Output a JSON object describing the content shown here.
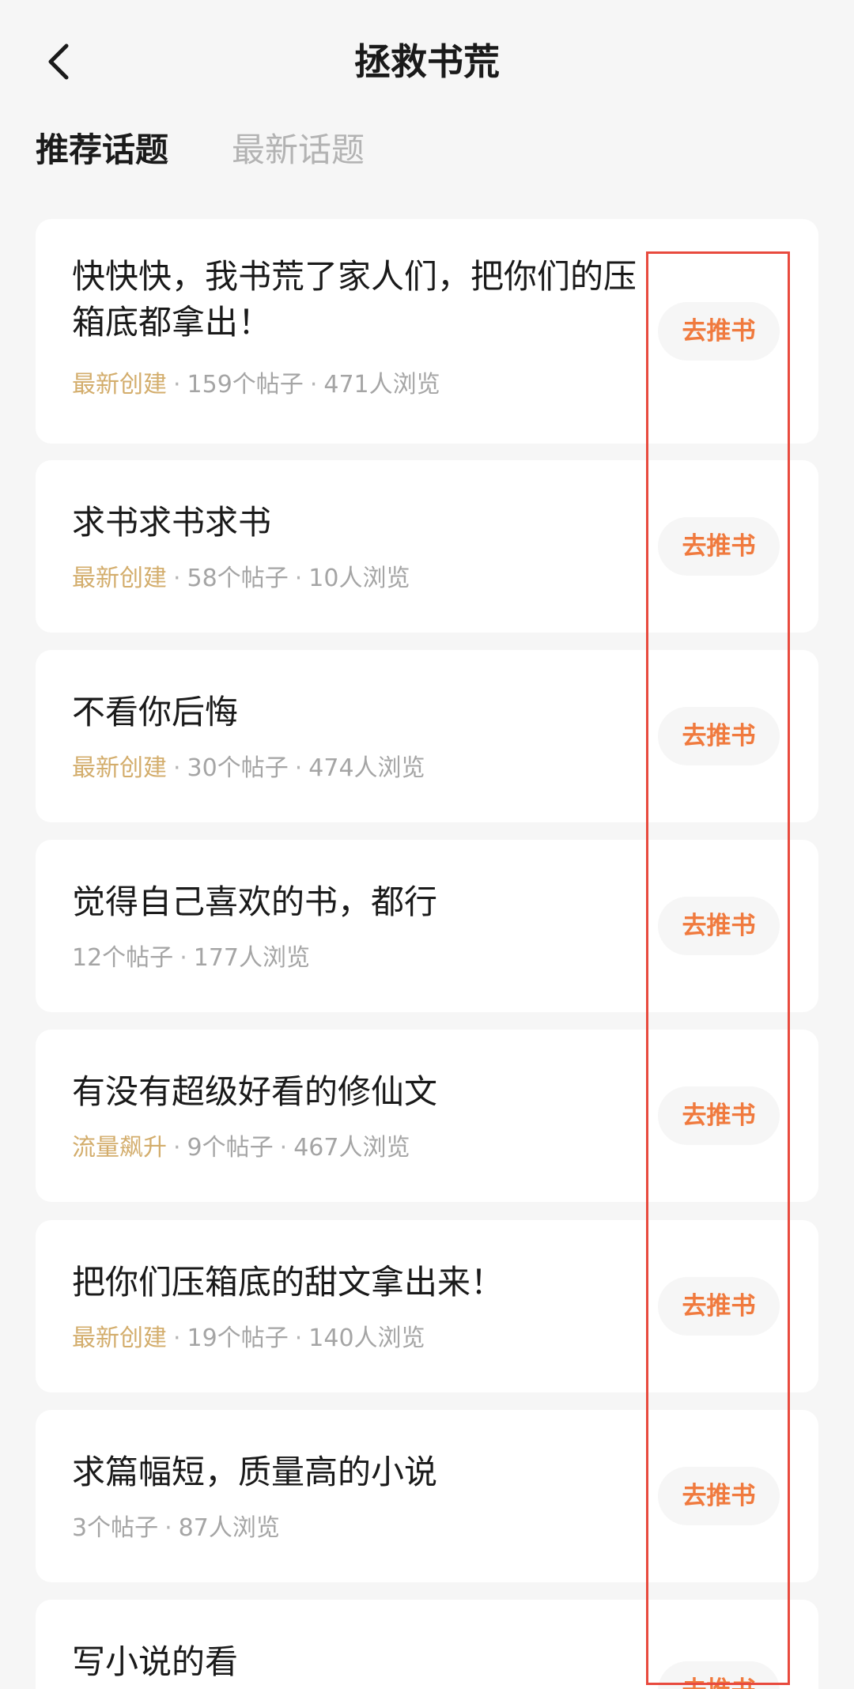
{
  "header": {
    "back_icon": "chevron-left-icon",
    "title": "拯救书荒"
  },
  "tabs": [
    {
      "label": "推荐话题",
      "active": true
    },
    {
      "label": "最新话题",
      "active": false
    }
  ],
  "topics": [
    {
      "title": "快快快，我书荒了家人们，把你们的压箱底都拿出！",
      "tag": "最新创建",
      "posts": "159个帖子",
      "views": "471人浏览",
      "action": "去推书"
    },
    {
      "title": "求书求书求书",
      "tag": "最新创建",
      "posts": "58个帖子",
      "views": "10人浏览",
      "action": "去推书"
    },
    {
      "title": "不看你后悔",
      "tag": "最新创建",
      "posts": "30个帖子",
      "views": "474人浏览",
      "action": "去推书"
    },
    {
      "title": "觉得自己喜欢的书，都行",
      "tag": "",
      "posts": "12个帖子",
      "views": "177人浏览",
      "action": "去推书"
    },
    {
      "title": "有没有超级好看的修仙文",
      "tag": "流量飙升",
      "posts": "9个帖子",
      "views": "467人浏览",
      "action": "去推书"
    },
    {
      "title": "把你们压箱底的甜文拿出来！",
      "tag": "最新创建",
      "posts": "19个帖子",
      "views": "140人浏览",
      "action": "去推书"
    },
    {
      "title": "求篇幅短，质量高的小说",
      "tag": "",
      "posts": "3个帖子",
      "views": "87人浏览",
      "action": "去推书"
    },
    {
      "title": "写小说的看",
      "tag": "",
      "posts": "",
      "views": "",
      "action": "去推书"
    }
  ],
  "colors": {
    "accent": "#f07a3e",
    "tag": "#d3ad6c",
    "highlight": "#e84a3e",
    "background": "#f6f6f6"
  },
  "separator": "·"
}
